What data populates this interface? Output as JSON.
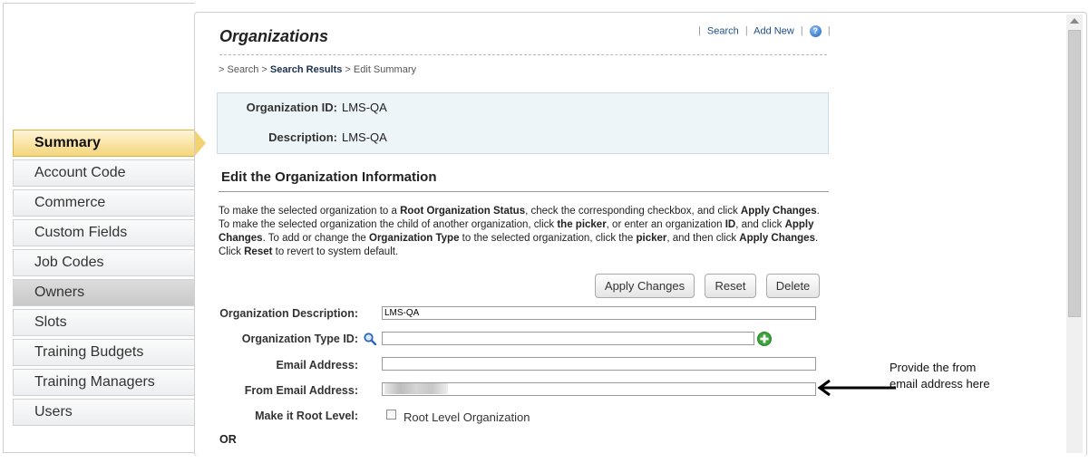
{
  "sidebar": {
    "items": [
      {
        "label": "Summary"
      },
      {
        "label": "Account Code"
      },
      {
        "label": "Commerce"
      },
      {
        "label": "Custom Fields"
      },
      {
        "label": "Job Codes"
      },
      {
        "label": "Owners"
      },
      {
        "label": "Slots"
      },
      {
        "label": "Training Budgets"
      },
      {
        "label": "Training Managers"
      },
      {
        "label": "Users"
      }
    ]
  },
  "page": {
    "title": "Organizations",
    "links": {
      "search": "Search",
      "add_new": "Add New",
      "help_glyph": "?"
    },
    "breadcrumb": {
      "search": "Search",
      "results": "Search Results",
      "current": "Edit Summary"
    }
  },
  "info": {
    "org_id_label": "Organization ID:",
    "org_id_value": "LMS-QA",
    "desc_label": "Description:",
    "desc_value": "LMS-QA"
  },
  "section": {
    "title": "Edit the Organization Information",
    "instructions": {
      "l1a": "To make the selected organization to a ",
      "l1b": "Root Organization Status",
      "l1c": ", check the corresponding checkbox, and click ",
      "l1d": "Apply Changes",
      "l1e": ".",
      "l2a": "To make the selected organization the child of another organization, click ",
      "l2b": "the picker",
      "l2c": ", or enter an organization ",
      "l2d": "ID",
      "l2e": ", and click ",
      "l2f": "Apply Changes",
      "l2g": ". To add or change the ",
      "l2h": "Organization Type",
      "l2i": " to the selected organization, click the ",
      "l2j": "picker",
      "l2k": ", and then click ",
      "l2l": "Apply Changes",
      "l2m": ".",
      "l3a": "Click ",
      "l3b": "Reset",
      "l3c": " to revert to system default."
    }
  },
  "buttons": {
    "apply": "Apply Changes",
    "reset": "Reset",
    "delete": "Delete"
  },
  "form": {
    "org_desc_label": "Organization Description:",
    "org_desc_value": "LMS-QA",
    "org_type_label": "Organization Type ID:",
    "org_type_value": "",
    "email_label": "Email Address:",
    "email_value": "",
    "from_email_label": "From Email Address:",
    "root_label": "Make it Root Level:",
    "root_checkbox_label": "Root Level Organization",
    "or_label": "OR"
  },
  "annotation": {
    "line1": "Provide the from",
    "line2": "email address here"
  },
  "icons": {
    "search": "search-icon",
    "add": "add-icon",
    "help": "help-icon",
    "arrow": "arrow-left-icon"
  }
}
